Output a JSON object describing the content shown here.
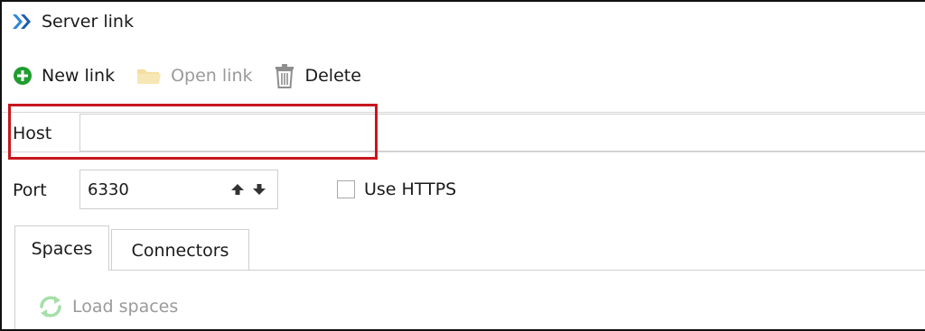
{
  "window": {
    "title": "Server link",
    "icon": "server-link-icon"
  },
  "toolbar": {
    "new_link": {
      "label": "New link",
      "icon": "plus-circle-icon"
    },
    "open_link": {
      "label": "Open link",
      "icon": "folder-icon",
      "disabled": true
    },
    "delete": {
      "label": "Delete",
      "icon": "trash-icon"
    }
  },
  "form": {
    "host": {
      "label": "Host",
      "value": ""
    },
    "port": {
      "label": "Port",
      "value": "6330"
    },
    "use_https": {
      "label": "Use HTTPS",
      "checked": false
    }
  },
  "tabs": [
    {
      "label": "Spaces",
      "active": true
    },
    {
      "label": "Connectors",
      "active": false
    }
  ],
  "spaces_panel": {
    "load_label": "Load spaces",
    "icon": "refresh-icon",
    "disabled": true
  },
  "colors": {
    "highlight": "#c8161d",
    "add_green": "#1f9d2f",
    "accent_blue": "#1e6fd0"
  }
}
